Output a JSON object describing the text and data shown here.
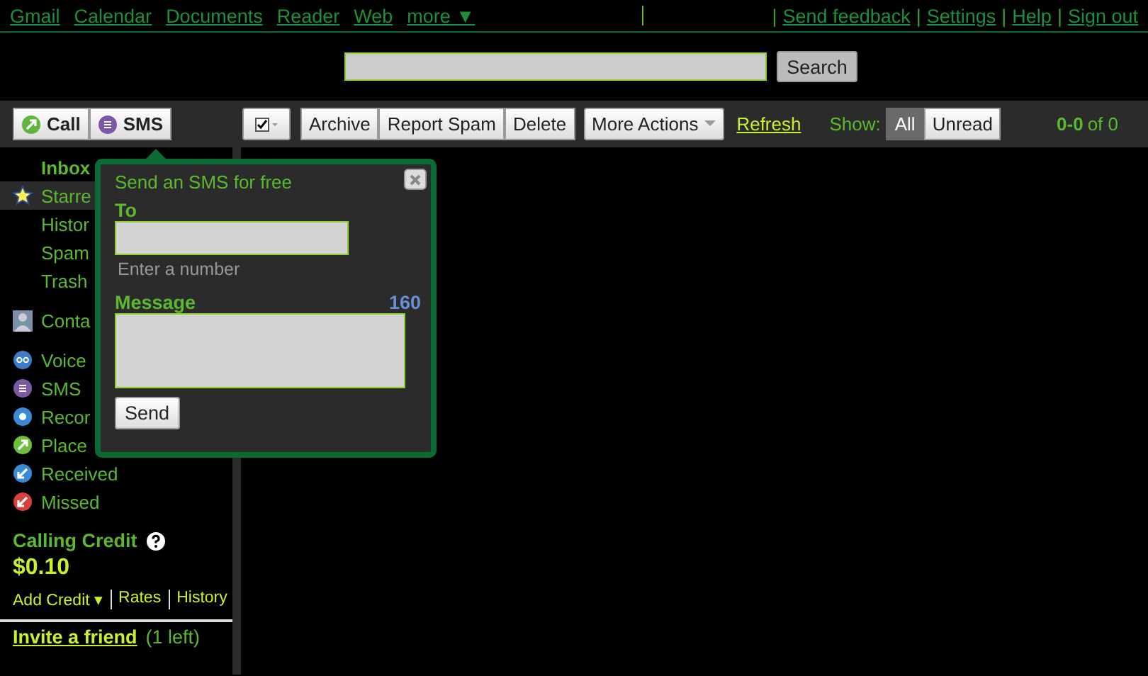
{
  "top_links": [
    "Gmail",
    "Calendar",
    "Documents",
    "Reader",
    "Web",
    "more ▼"
  ],
  "account_links": [
    {
      "kind": "separator",
      "text": "|"
    },
    {
      "kind": "link",
      "text": "Send feedback"
    },
    {
      "kind": "separator",
      "text": "|"
    },
    {
      "kind": "link",
      "text": "Settings"
    },
    {
      "kind": "separator",
      "text": "|"
    },
    {
      "kind": "link",
      "text": "Help"
    },
    {
      "kind": "separator",
      "text": "|"
    },
    {
      "kind": "link",
      "text": "Sign out"
    }
  ],
  "search": {
    "button": "Search"
  },
  "call_buttons": [
    {
      "label": "Call",
      "kind": "call"
    },
    {
      "label": "SMS",
      "kind": "sms"
    }
  ],
  "toolbar": {
    "actions": [
      "Archive",
      "Report Spam",
      "Delete"
    ],
    "more_actions": "More Actions",
    "refresh": "Refresh",
    "show_label": "Show:",
    "filters": [
      {
        "label": "All",
        "selected": true
      },
      {
        "label": "Unread",
        "selected": false
      }
    ],
    "range": "0-0",
    "of": "of 0"
  },
  "sidebar": {
    "folders": [
      {
        "label": "Inbox",
        "selected": false,
        "kind": "plain"
      },
      {
        "label": "Starre",
        "selected": true,
        "kind": "star"
      },
      {
        "label": "Histor",
        "selected": false,
        "kind": "plain"
      },
      {
        "label": "Spam",
        "selected": false,
        "kind": "plain"
      },
      {
        "label": "Trash",
        "selected": false,
        "kind": "plain"
      }
    ],
    "contacts": "Conta",
    "types": [
      {
        "label": "Voice",
        "kind": "voicemail"
      },
      {
        "label": "SMS",
        "kind": "sms"
      },
      {
        "label": "Recor",
        "kind": "record"
      },
      {
        "label": "Place",
        "kind": "placed"
      },
      {
        "label": "Received",
        "kind": "received"
      },
      {
        "label": "Missed",
        "kind": "missed"
      }
    ],
    "credit_title": "Calling Credit",
    "credit_amount": "$0.10",
    "credit_links": [
      "Add Credit ▾",
      "Rates",
      "History"
    ],
    "invite": "Invite a friend",
    "invite_note": "(1 left)"
  },
  "sms_popup": {
    "title": "Send an SMS for free",
    "to_label": "To",
    "to_hint": "Enter a number",
    "message_label": "Message",
    "counter": "160",
    "send": "Send"
  }
}
